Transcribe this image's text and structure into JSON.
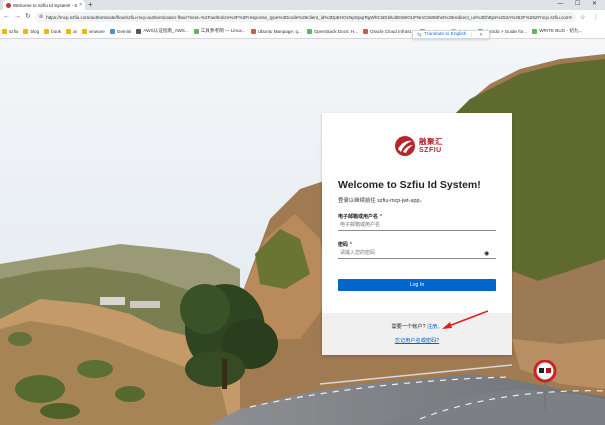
{
  "browser": {
    "tab": {
      "title": "Welcome to Szfiu Id System! - Szf",
      "close": "×"
    },
    "new_tab": "+",
    "window_controls": "— ☐ ✕",
    "nav": {
      "back": "←",
      "forward": "→",
      "reload": "↻"
    },
    "url": "https://mcp.szfiu.com/authenticate/flow/szfiu-mcp-authentication-flow/?next=%2Fauthorize%2F%3Fresponse_type%3Dcode%26client_id%3DpEHOcNpSpqrRgWhCsDIIdUdE5WOUFNmC5WMhst%26redirect_uri%3Dhttps%253A%252F%252Fmcp.szfiu.com%252Fauth%252F",
    "toolbar_right": "☆ ⋮",
    "bookmarks": [
      {
        "label": "szfiu",
        "icon": "folder"
      },
      {
        "label": "blog",
        "icon": "folder"
      },
      {
        "label": "book",
        "icon": "folder"
      },
      {
        "label": "ai",
        "icon": "folder"
      },
      {
        "label": "vmware",
        "icon": "folder"
      },
      {
        "label": "Gemini",
        "icon": "gemini"
      },
      {
        "label": "AWS认证指南_AWS...",
        "icon": "aws"
      },
      {
        "label": "工具参考网 — Linux...",
        "icon": "site"
      },
      {
        "label": "Ubuntu Manpage: q...",
        "icon": "ubuntu"
      },
      {
        "label": "OpenStack Docs: H...",
        "icon": "site"
      },
      {
        "label": "Oracle Cloud Infrast...",
        "icon": "oracle"
      },
      {
        "label": "Szpace...",
        "icon": "site"
      },
      {
        "label": "cheese",
        "icon": "folder"
      },
      {
        "label": "chezdo > Guide for...",
        "icon": "site"
      },
      {
        "label": "WRITE BUG - 初九...",
        "icon": "site"
      }
    ],
    "translate": {
      "label": "Translate to English",
      "controls": "⋮ ✕"
    }
  },
  "login": {
    "logo_cn": "融聚汇",
    "logo_en": "SZFIU",
    "title": "Welcome to Szfiu Id System!",
    "subtitle": "登录以继续前往 szfiu-mcp-jwt-app。",
    "username": {
      "label": "电子邮箱或用户名",
      "required": "*",
      "placeholder": "电子邮箱或用户名",
      "value": ""
    },
    "password": {
      "label": "密码",
      "required": "*",
      "placeholder": "请输入您的密码",
      "value": ""
    },
    "login_button": "Log In",
    "signup_prompt": "需要一个帐户?",
    "signup_link": "注册。",
    "forgot_link": "忘记用户名或密码?"
  },
  "colors": {
    "accent": "#0066cc",
    "brand": "#b4282d",
    "annotation_arrow": "#e02020"
  }
}
